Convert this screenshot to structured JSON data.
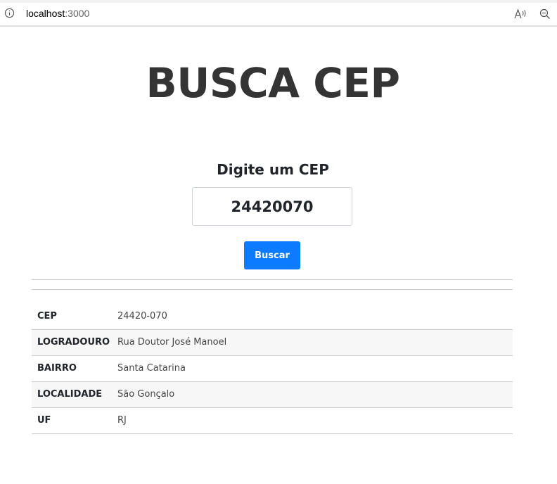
{
  "browser": {
    "url_host": "localhost",
    "url_port": ":3000",
    "icons": [
      "info-icon",
      "read-aloud-icon",
      "zoom-out-icon"
    ]
  },
  "page": {
    "title": "BUSCA CEP",
    "subtitle": "Digite um CEP",
    "cep_input_value": "24420070",
    "search_button_label": "Buscar"
  },
  "result": {
    "rows": [
      {
        "label": "CEP",
        "value": "24420-070"
      },
      {
        "label": "LOGRADOURO",
        "value": "Rua Doutor José Manoel"
      },
      {
        "label": "BAIRRO",
        "value": "Santa Catarina"
      },
      {
        "label": "LOCALIDADE",
        "value": "São Gonçalo"
      },
      {
        "label": "UF",
        "value": "RJ"
      }
    ]
  },
  "colors": {
    "button": "#0d7bff",
    "title": "#343434"
  }
}
